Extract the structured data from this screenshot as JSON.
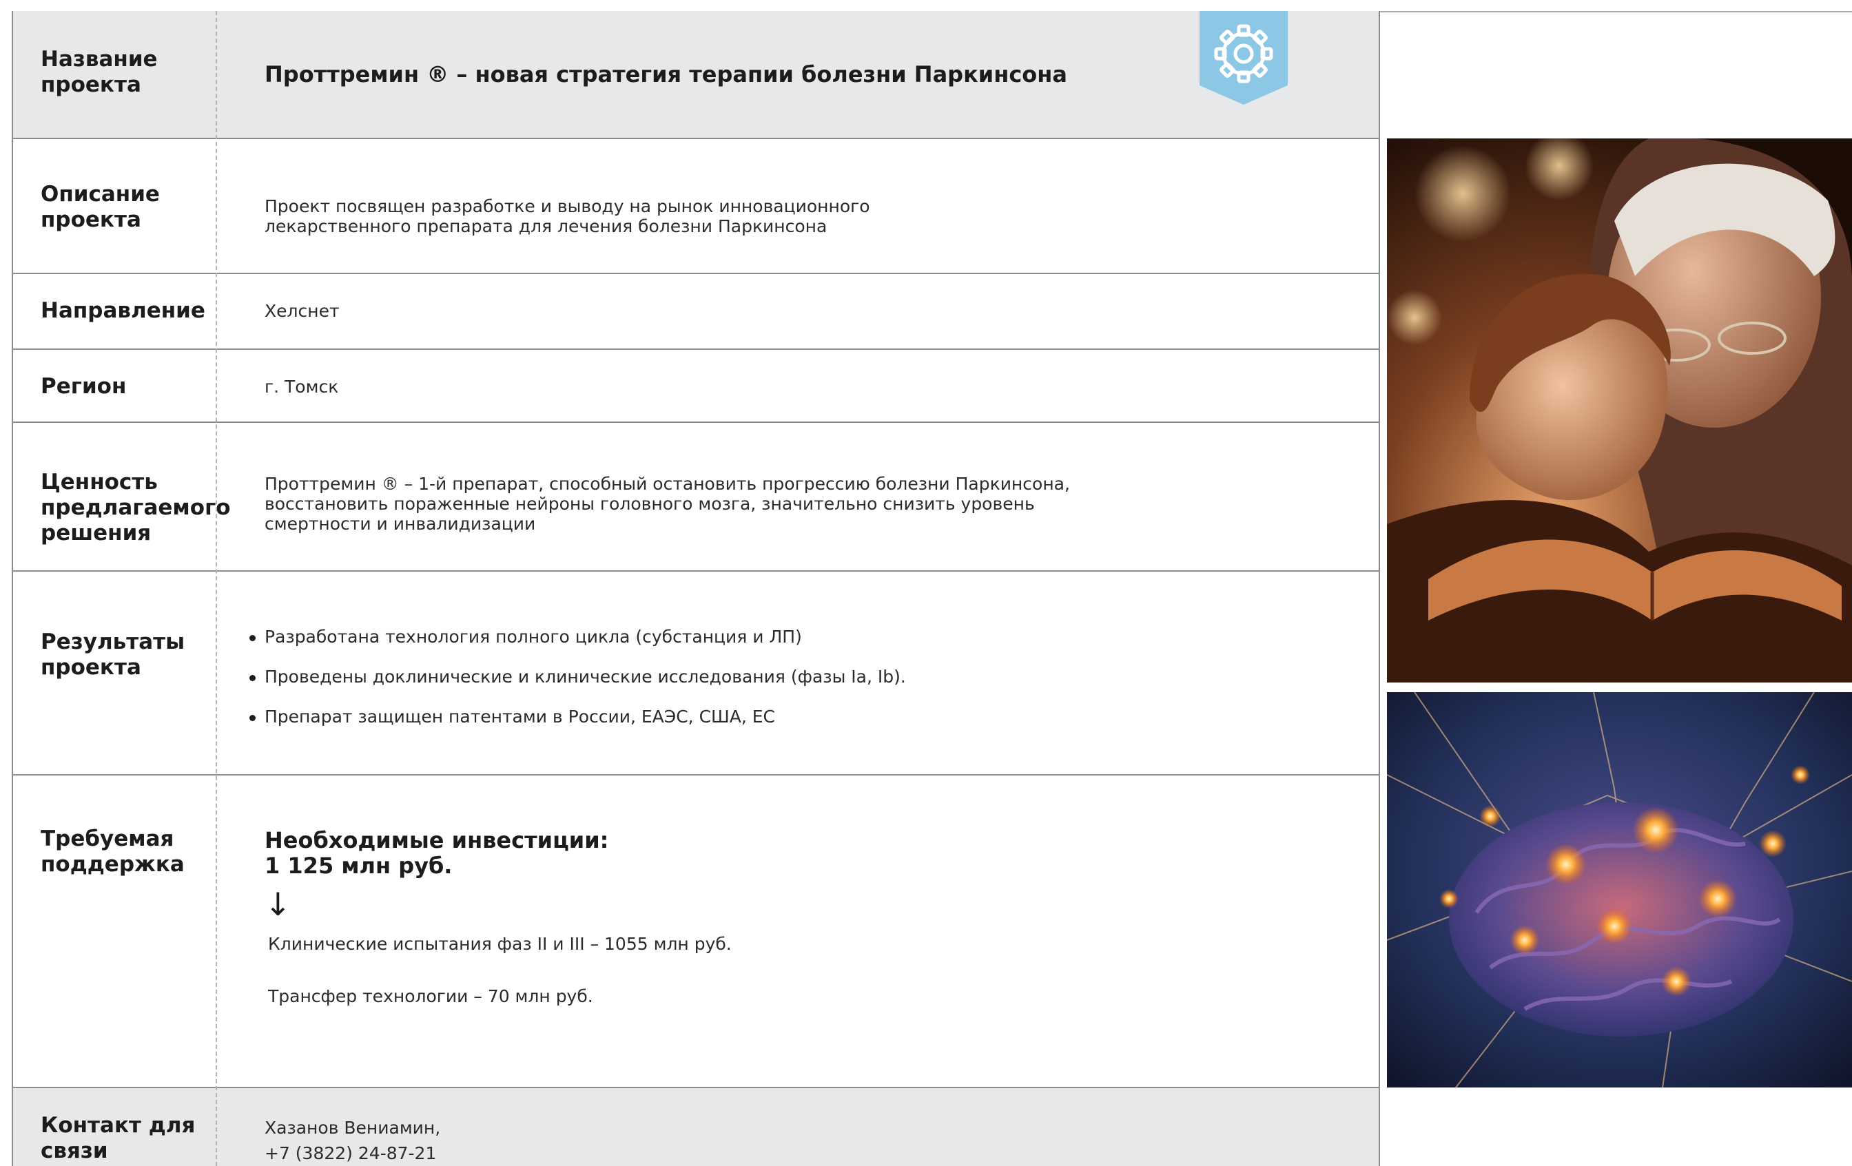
{
  "rows": {
    "name": {
      "label": "Название проекта",
      "value": "Проттремин ® – новая стратегия терапии болезни Паркинсона"
    },
    "description": {
      "label": "Описание проекта",
      "value": "Проект посвящен разработке и выводу на рынок инновационного лекарственного препарата для лечения болезни Паркинсона"
    },
    "direction": {
      "label": "Направление",
      "value": "Хелснет"
    },
    "region": {
      "label": "Регион",
      "value": "г. Томск"
    },
    "value": {
      "label": "Ценность предлагаемого решения",
      "value": "Проттремин ® – 1-й препарат, способный остановить прогрессию болезни Паркинсона, восстановить пораженные нейроны головного мозга, значительно снизить уровень смертности и инвалидизации"
    },
    "results": {
      "label": "Результаты проекта",
      "items": [
        "Разработана технология полного цикла (субстанция и ЛП)",
        "Проведены доклинические и клинические исследования (фазы Ia, Ib).",
        "Препарат защищен патентами в России, ЕАЭС, США, ЕС"
      ]
    },
    "support": {
      "label": "Требуемая поддержка",
      "investment_title": "Необходимые инвестиции:",
      "investment_amount": "1 125 млн руб.",
      "arrow": "↓",
      "items": [
        "Клинические испытания фаз II и III – 1055 млн руб.",
        "Трансфер технологии – 70 млн руб."
      ]
    },
    "contact": {
      "label": "Контакт для связи",
      "name": "Хазанов Вениамин,",
      "phone": "+7 (3822) 24-87-21"
    }
  },
  "icons": {
    "badge": "gear-icon"
  },
  "colors": {
    "badge": "#8cc7e6",
    "header_bg": "#e7e8ea",
    "border": "#8c8c8c"
  }
}
